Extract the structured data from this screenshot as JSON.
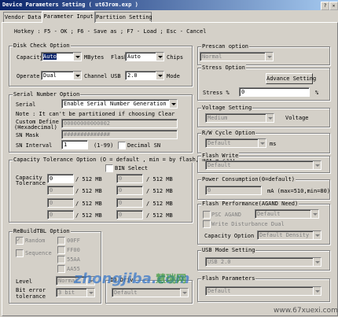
{
  "window": {
    "title": "Device Parameters Setting ( ut63rom.exp )"
  },
  "tabs": [
    {
      "label": "Vendor Data"
    },
    {
      "label": "Parameter Input"
    },
    {
      "label": "Partition Setting"
    }
  ],
  "hotkey": "Hotkey : F5 - OK ; F6 - Save as ; F7 - Load ; Esc - Cancel",
  "disk_check": {
    "title": "Disk Check Option",
    "capacity_label": "Capacity",
    "capacity_value": "Auto",
    "mbytes_label": "MBytes",
    "flash_label": "Flash",
    "flash_value": "Auto",
    "chips_label": "Chips",
    "operate_label": "Operate",
    "operate_value": "Dual",
    "channel_label": "Channel",
    "usb_label": "USB",
    "usb_value": "2.0",
    "mode_label": "Mode"
  },
  "serial": {
    "title": "Serial Number Option",
    "serial_label": "Serial",
    "serial_value": "Enable Serial Number Generation",
    "note": "Note : It can't be partitioned if choosing Clear",
    "custom_label1": "Custom Define",
    "custom_label2": "(Hexadecimal)",
    "custom_value": "00000000000002",
    "mask_label": "SN Mask",
    "mask_value": "##############",
    "interval_label": "SN Interval",
    "interval_value": "1",
    "interval_range": "(1-99)",
    "decimal_label": "Decimal SN"
  },
  "capacity_tol": {
    "title": "Capacity Tolerance Option (O = default , min = by flash, max = 255)",
    "bin_label": "BIN Select",
    "cap_label1": "Capacity",
    "cap_label2": "Tolerance",
    "unit": "/ 512 MB",
    "rows": [
      {
        "a": "0",
        "b": "0"
      },
      {
        "a": "0",
        "b": "0"
      },
      {
        "a": "0",
        "b": "0"
      },
      {
        "a": "0",
        "b": "0"
      }
    ]
  },
  "rebuild": {
    "title": "ReBuildTBL Option",
    "random_label": "Random",
    "sequence_label": "Sequence",
    "opts": [
      "00FF",
      "FF00",
      "55AA",
      "AA55"
    ],
    "level_label": "Level",
    "level_value": "Normal",
    "biterr_label1": "Bit error",
    "biterr_label2": "tolerance",
    "biterr_value": "3 bit"
  },
  "io_driving": {
    "title": "IO Driv",
    "value": "Default"
  },
  "prescan": {
    "title": "Prescan option",
    "value": "Normal"
  },
  "stress": {
    "title": "Stress Option",
    "button": "Advance Setting",
    "pct_label": "Stress %",
    "pct_value": "0",
    "pct_unit": "%"
  },
  "voltage": {
    "title": "Voltage Setting",
    "value": "Medium",
    "label": "Voltage"
  },
  "rw_cycle": {
    "title": "R/W Cycle Option",
    "value": "Default",
    "unit": "ms"
  },
  "flash_write": {
    "title": "Flash Write",
    "value": "Default"
  },
  "power": {
    "title": "Power Consumption(0=default)",
    "value": "0",
    "unit": "mA (max=510,min=80)"
  },
  "flash_perf": {
    "title": "Flash Performance(AGAND Need)",
    "psc_label": "PSC AGAND",
    "psc_value": "Default",
    "wdd_label": "Write Disturbance Dual",
    "cap_label": "Capacity Option",
    "cap_value": "Default Density"
  },
  "usb_mode": {
    "title": "USB Mode Setting",
    "value": "USB 2.0"
  },
  "flash_params": {
    "title": "Flash Parameters",
    "value": "Default"
  },
  "watermark": {
    "brand": "zhongjiba.com",
    "cn": "慧瑞网",
    "site": "www.67xuexi.com"
  },
  "colors": {
    "titlebar": "#0a246a",
    "face": "#d4d0c8",
    "watermark_blue": "#3a78c8"
  }
}
